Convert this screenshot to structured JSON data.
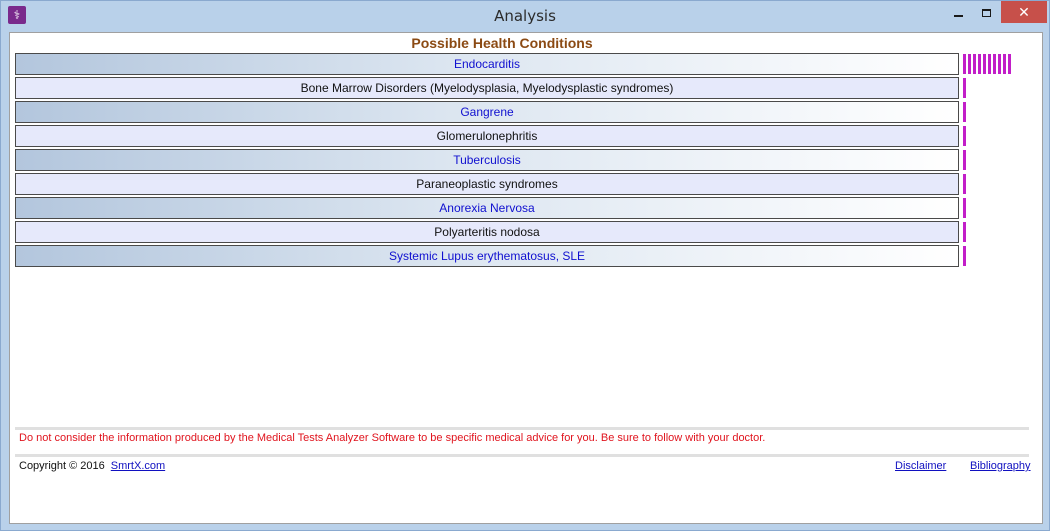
{
  "window": {
    "title": "Analysis",
    "app_icon_glyph": "⚕",
    "minimize_glyph": "",
    "close_glyph": "✕"
  },
  "heading": "Possible Health Conditions",
  "conditions": [
    {
      "label": "Endocarditis",
      "score": 1.0
    },
    {
      "label": "Bone Marrow Disorders (Myelodysplasia, Myelodysplastic syndromes)",
      "score": 0.06
    },
    {
      "label": "Gangrene",
      "score": 0.06
    },
    {
      "label": "Glomerulonephritis",
      "score": 0.06
    },
    {
      "label": "Tuberculosis",
      "score": 0.06
    },
    {
      "label": "Paraneoplastic syndromes",
      "score": 0.06
    },
    {
      "label": "Anorexia Nervosa",
      "score": 0.06
    },
    {
      "label": "Polyarteritis nodosa",
      "score": 0.06
    },
    {
      "label": "Systemic Lupus erythematosus, SLE",
      "score": 0.06
    }
  ],
  "disclaimer_text": "Do not consider the information produced by the Medical Tests Analyzer Software to be specific medical advice for you. Be sure to follow with your doctor.",
  "footer": {
    "copyright": "Copyright © 2016",
    "site_link": "SmrtX.com",
    "disclaimer_link": "Disclaimer",
    "bibliography_link": "Bibliography"
  },
  "colors": {
    "heading": "#8b4a13",
    "link_row_text": "#1010d0",
    "score_bar": "#c21ec8",
    "disclaimer": "#e0141e"
  }
}
